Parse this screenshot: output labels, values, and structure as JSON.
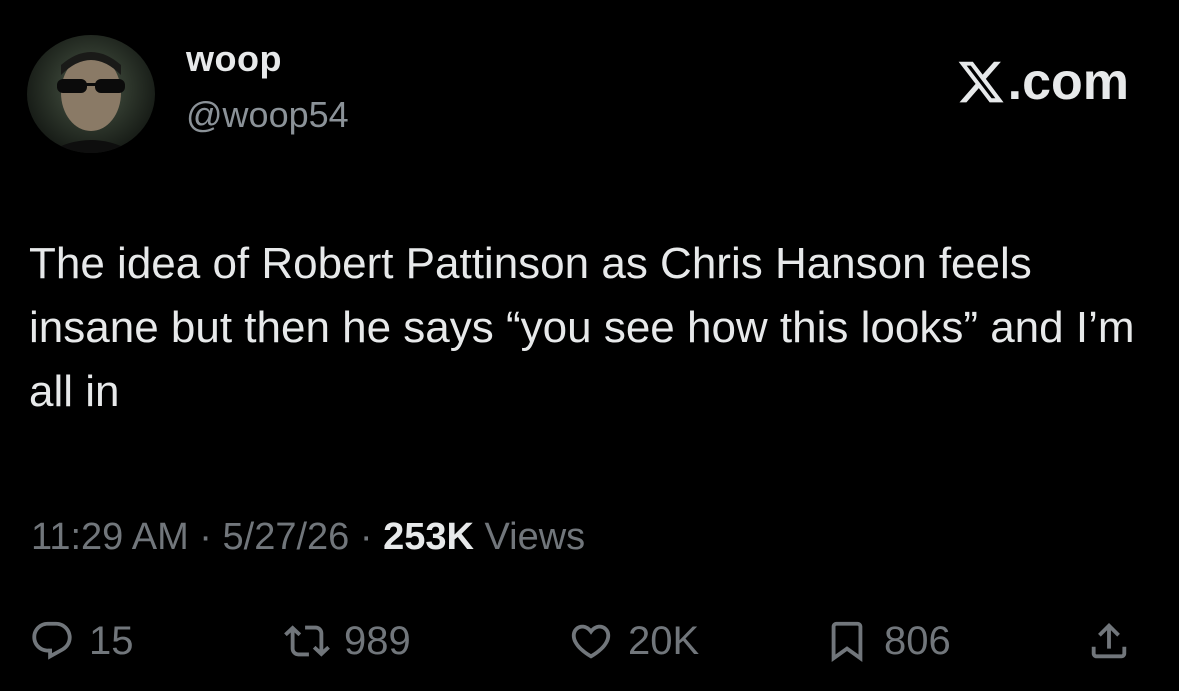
{
  "author": {
    "display_name": "woop",
    "handle": "@woop54"
  },
  "brand": {
    "text": ".com",
    "logo_icon": "x-logo-icon"
  },
  "tweet": {
    "text": "The idea of Robert Pattinson as Chris Hanson feels insane but then he says “you see how this looks” and I’m all in"
  },
  "meta": {
    "time": "11:29 AM",
    "sep1": " · ",
    "date": "5/27/26",
    "sep2": " · ",
    "views_count": "253K",
    "views_label": " Views"
  },
  "actions": {
    "replies": "15",
    "reposts": "989",
    "likes": "20K",
    "bookmarks": "806"
  },
  "colors": {
    "background": "#000000",
    "primary_text": "#e7e9ea",
    "secondary_text": "#71767b"
  }
}
